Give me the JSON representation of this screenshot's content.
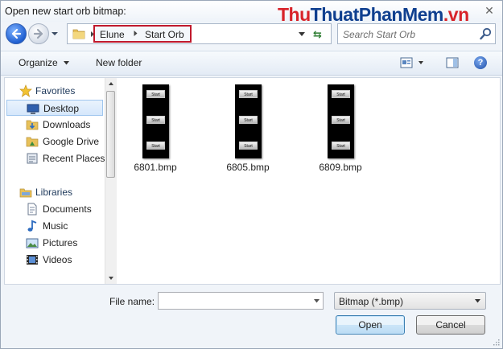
{
  "window": {
    "title": "Open new start orb bitmap:"
  },
  "watermark": {
    "part1": "Thu",
    "part2": "ThuatPhanMem",
    "part3": ".vn"
  },
  "address": {
    "crumbs": [
      "Elune",
      "Start Orb"
    ]
  },
  "search": {
    "placeholder": "Search Start Orb"
  },
  "toolbar": {
    "organize": "Organize",
    "new_folder": "New folder"
  },
  "nav": {
    "favorites": {
      "label": "Favorites",
      "items": [
        "Desktop",
        "Downloads",
        "Google Drive",
        "Recent Places"
      ],
      "selected": "Desktop"
    },
    "libraries": {
      "label": "Libraries",
      "items": [
        "Documents",
        "Music",
        "Pictures",
        "Videos"
      ]
    }
  },
  "files": [
    {
      "name": "6801.bmp",
      "orb_labels": [
        "Start",
        "Start",
        "Start"
      ]
    },
    {
      "name": "6805.bmp",
      "orb_labels": [
        "Start",
        "Start",
        "Start"
      ]
    },
    {
      "name": "6809.bmp",
      "orb_labels": [
        "Start",
        "Start",
        "Start"
      ]
    }
  ],
  "bottom": {
    "file_name_label": "File name:",
    "file_name_value": "",
    "file_type": "Bitmap (*.bmp)",
    "open_label": "Open",
    "cancel_label": "Cancel"
  },
  "colors": {
    "crumb_highlight": "#c0192c",
    "watermark_red": "#d8232a",
    "watermark_blue": "#0f3f8f"
  }
}
